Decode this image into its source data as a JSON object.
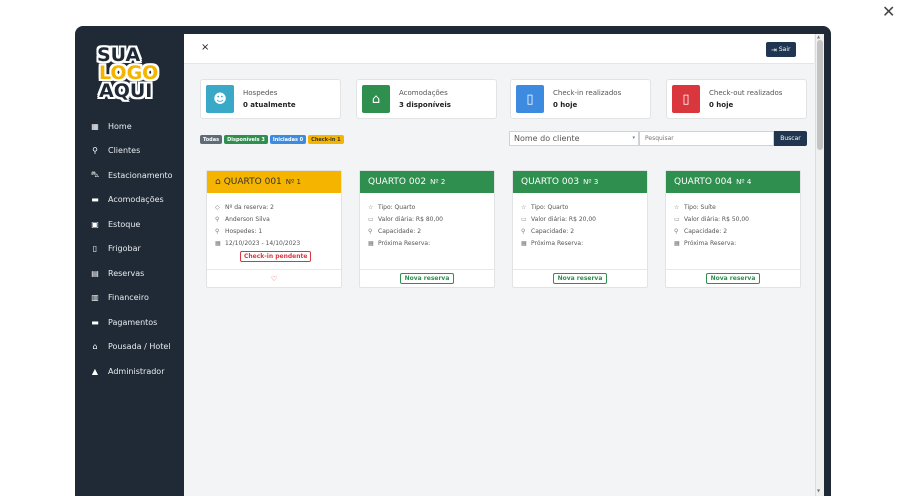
{
  "app": {
    "logo": [
      "SUA",
      "LOGO",
      "AQUI"
    ],
    "page_close": "✕"
  },
  "sidebar": {
    "items": [
      {
        "label": "Home",
        "icon": "grid-icon",
        "glyph": "▦"
      },
      {
        "label": "Clientes",
        "icon": "user-icon",
        "glyph": "⚲"
      },
      {
        "label": "Estacionamento",
        "icon": "car-icon",
        "glyph": "⛍"
      },
      {
        "label": "Acomodações",
        "icon": "bed-icon",
        "glyph": "▬"
      },
      {
        "label": "Estoque",
        "icon": "box-icon",
        "glyph": "▣"
      },
      {
        "label": "Frigobar",
        "icon": "fridge-icon",
        "glyph": "▯"
      },
      {
        "label": "Reservas",
        "icon": "calendar-icon",
        "glyph": "▤"
      },
      {
        "label": "Financeiro",
        "icon": "receipt-icon",
        "glyph": "▥"
      },
      {
        "label": "Pagamentos",
        "icon": "card-icon",
        "glyph": "▬"
      },
      {
        "label": "Pousada / Hotel",
        "icon": "house-icon",
        "glyph": "⌂"
      },
      {
        "label": "Administrador",
        "icon": "lock-icon",
        "glyph": "▲"
      }
    ]
  },
  "topbar": {
    "close": "×",
    "logout_label": "Sair",
    "logout_icon": "⇥"
  },
  "stats": [
    {
      "label": "Hospedes",
      "value": "0 atualmente",
      "color": "#3aa8c7",
      "icon": "users-icon",
      "glyph": "☻"
    },
    {
      "label": "Acomodações",
      "value": "3 disponíveis",
      "color": "#2f8f4f",
      "icon": "home-icon",
      "glyph": "⌂"
    },
    {
      "label": "Check-in realizados",
      "value": "0 hoje",
      "color": "#3c8be0",
      "icon": "door-in-icon",
      "glyph": "▯"
    },
    {
      "label": "Check-out realizados",
      "value": "0 hoje",
      "color": "#d9363e",
      "icon": "door-out-icon",
      "glyph": "▯"
    }
  ],
  "filters": [
    {
      "label": "Todas",
      "color": "#5f6b76"
    },
    {
      "label": "Disponíveis 3",
      "color": "#2f8f4f"
    },
    {
      "label": "Iniciadas 0",
      "color": "#3c8be0"
    },
    {
      "label": "Check-in 1",
      "color": "#f4b400",
      "text_color": "#333333"
    }
  ],
  "search": {
    "select_value": "Nome do cliente",
    "placeholder": "Pesquisar",
    "button": "Buscar"
  },
  "rooms": [
    {
      "title": "QUARTO 001",
      "num": "Nº 1",
      "color": "#f4b400",
      "lines": [
        {
          "glyph": "◇",
          "text": "Nº da reserva: 2"
        },
        {
          "glyph": "⚲",
          "text": "Anderson Silva"
        },
        {
          "glyph": "⚲",
          "text": "Hospedes: 1"
        },
        {
          "glyph": "▦",
          "text": "12/10/2023 - 14/10/2023"
        }
      ],
      "status": "Check-in pendente",
      "footer_icon": "♡"
    },
    {
      "title": "QUARTO 002",
      "num": "Nº 2",
      "color": "#2f8f4f",
      "lines": [
        {
          "glyph": "☆",
          "text": "Tipo: Quarto"
        },
        {
          "glyph": "▭",
          "text": "Valor diária: R$ 80,00"
        },
        {
          "glyph": "⚲",
          "text": "Capacidade: 2"
        },
        {
          "glyph": "▦",
          "text": "Próxima Reserva:"
        }
      ],
      "footer": "Nova reserva"
    },
    {
      "title": "QUARTO 003",
      "num": "Nº 3",
      "color": "#2f8f4f",
      "lines": [
        {
          "glyph": "☆",
          "text": "Tipo: Quarto"
        },
        {
          "glyph": "▭",
          "text": "Valor diária: R$ 20,00"
        },
        {
          "glyph": "⚲",
          "text": "Capacidade: 2"
        },
        {
          "glyph": "▦",
          "text": "Próxima Reserva:"
        }
      ],
      "footer": "Nova reserva"
    },
    {
      "title": "QUARTO 004",
      "num": "Nº 4",
      "color": "#2f8f4f",
      "lines": [
        {
          "glyph": "☆",
          "text": "Tipo: Suíte"
        },
        {
          "glyph": "▭",
          "text": "Valor diária: R$ 50,00"
        },
        {
          "glyph": "⚲",
          "text": "Capacidade: 2"
        },
        {
          "glyph": "▦",
          "text": "Próxima Reserva:"
        }
      ],
      "footer": "Nova reserva"
    }
  ]
}
